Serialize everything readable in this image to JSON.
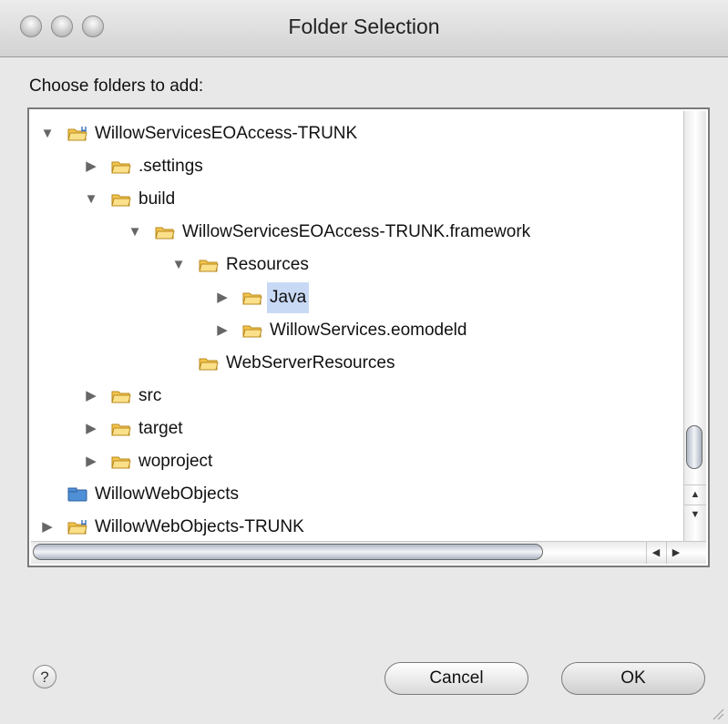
{
  "window": {
    "title": "Folder Selection"
  },
  "prompt": "Choose folders to add:",
  "tree": [
    {
      "label": "WillowServicesEOAccess-TRUNK",
      "depth": 0,
      "toggle": "expanded",
      "icon": "project-folder-icon",
      "selected": false
    },
    {
      "label": ".settings",
      "depth": 1,
      "toggle": "collapsed",
      "icon": "folder-icon",
      "selected": false
    },
    {
      "label": "build",
      "depth": 1,
      "toggle": "expanded",
      "icon": "folder-icon",
      "selected": false
    },
    {
      "label": "WillowServicesEOAccess-TRUNK.framework",
      "depth": 2,
      "toggle": "expanded",
      "icon": "folder-icon",
      "selected": false
    },
    {
      "label": "Resources",
      "depth": 3,
      "toggle": "expanded",
      "icon": "folder-icon",
      "selected": false
    },
    {
      "label": "Java",
      "depth": 4,
      "toggle": "collapsed",
      "icon": "folder-icon",
      "selected": true
    },
    {
      "label": "WillowServices.eomodeld",
      "depth": 4,
      "toggle": "collapsed",
      "icon": "folder-icon",
      "selected": false
    },
    {
      "label": "WebServerResources",
      "depth": 3,
      "toggle": "none",
      "icon": "folder-icon",
      "selected": false
    },
    {
      "label": "src",
      "depth": 1,
      "toggle": "collapsed",
      "icon": "folder-icon",
      "selected": false
    },
    {
      "label": "target",
      "depth": 1,
      "toggle": "collapsed",
      "icon": "folder-icon",
      "selected": false
    },
    {
      "label": "woproject",
      "depth": 1,
      "toggle": "collapsed",
      "icon": "folder-icon",
      "selected": false
    },
    {
      "label": "WillowWebObjects",
      "depth": 0,
      "toggle": "none",
      "icon": "closed-project-icon",
      "selected": false
    },
    {
      "label": "WillowWebObjects-TRUNK",
      "depth": 0,
      "toggle": "collapsed",
      "icon": "project-folder-icon",
      "selected": false
    }
  ],
  "buttons": {
    "cancel": "Cancel",
    "ok": "OK",
    "help": "?"
  },
  "colors": {
    "selection": "#c8d9f5",
    "folder": "#f3c44e"
  }
}
